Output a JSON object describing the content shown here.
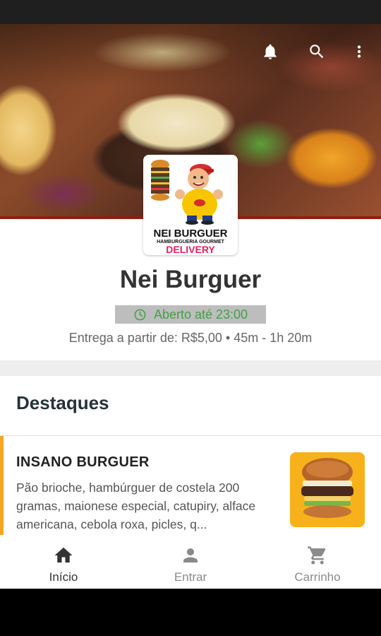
{
  "header": {
    "icons": [
      "bell-icon",
      "search-icon",
      "more-vert-icon"
    ]
  },
  "logo": {
    "title": "NEI BURGUER",
    "subtitle": "HAMBURGUERIA GOURMET",
    "tagline": "DELIVERY"
  },
  "store": {
    "name": "Nei Burguer",
    "status": "Aberto até 23:00",
    "status_color": "#43a047",
    "delivery_info": "Entrega a partir de: R$5,00 • 45m - 1h 20m"
  },
  "highlights": {
    "title": "Destaques",
    "items": [
      {
        "name": "INSANO BURGUER",
        "description": "Pão brioche, hambúrguer de costela 200 gramas, maionese especial, catupiry, alface americana, cebola roxa, picles, q...",
        "accent_color": "#f5a623"
      }
    ]
  },
  "bottom_nav": {
    "items": [
      {
        "label": "Início",
        "icon": "home-icon",
        "active": true
      },
      {
        "label": "Entrar",
        "icon": "person-icon",
        "active": false
      },
      {
        "label": "Carrinho",
        "icon": "cart-icon",
        "active": false
      }
    ]
  }
}
